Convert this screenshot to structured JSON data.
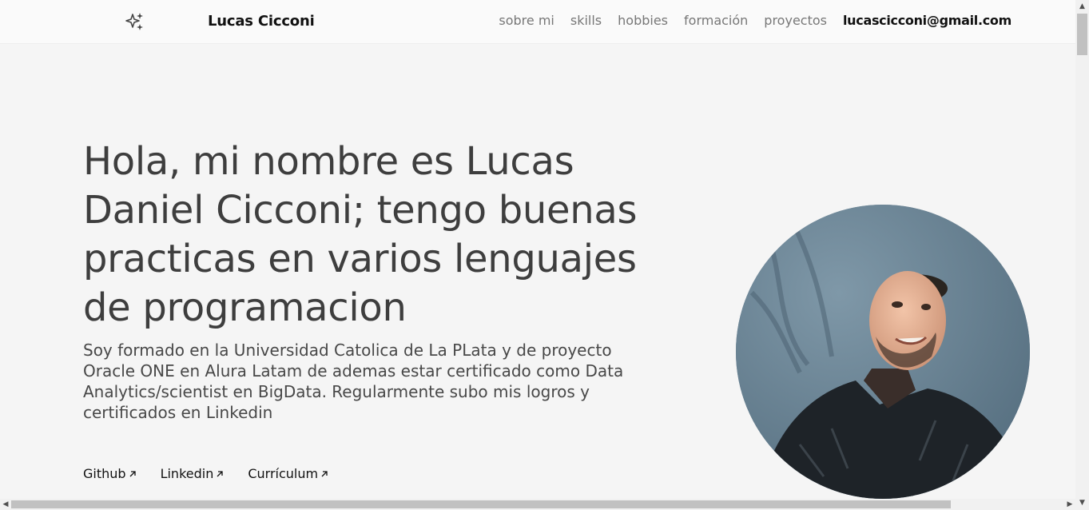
{
  "header": {
    "logo_icon": "sparkles-icon",
    "brand": "Lucas Cicconi",
    "nav": [
      "sobre mi",
      "skills",
      "hobbies",
      "formación",
      "proyectos"
    ],
    "email": "lucascicconi@gmail.com"
  },
  "hero": {
    "headline": "Hola, mi nombre es Lucas Daniel Cicconi; tengo buenas practicas en varios lenguajes de programacion",
    "intro": "Soy formado en la Universidad Catolica de La PLata y de proyecto Oracle ONE en Alura Latam de ademas estar certificado como Data Analytics/scientist en BigData. Regularmente subo mis logros y certificados en Linkedin",
    "links": [
      "Github",
      "Linkedin",
      "Currículum"
    ],
    "link_icon": "arrow-up-right-icon",
    "photo": "profile-photo"
  },
  "colors": {
    "background": "#f5f5f5",
    "header_bg": "#fafafa",
    "heading_text": "#3e3e3e",
    "nav_text": "#777777",
    "accent_text": "#111111"
  }
}
